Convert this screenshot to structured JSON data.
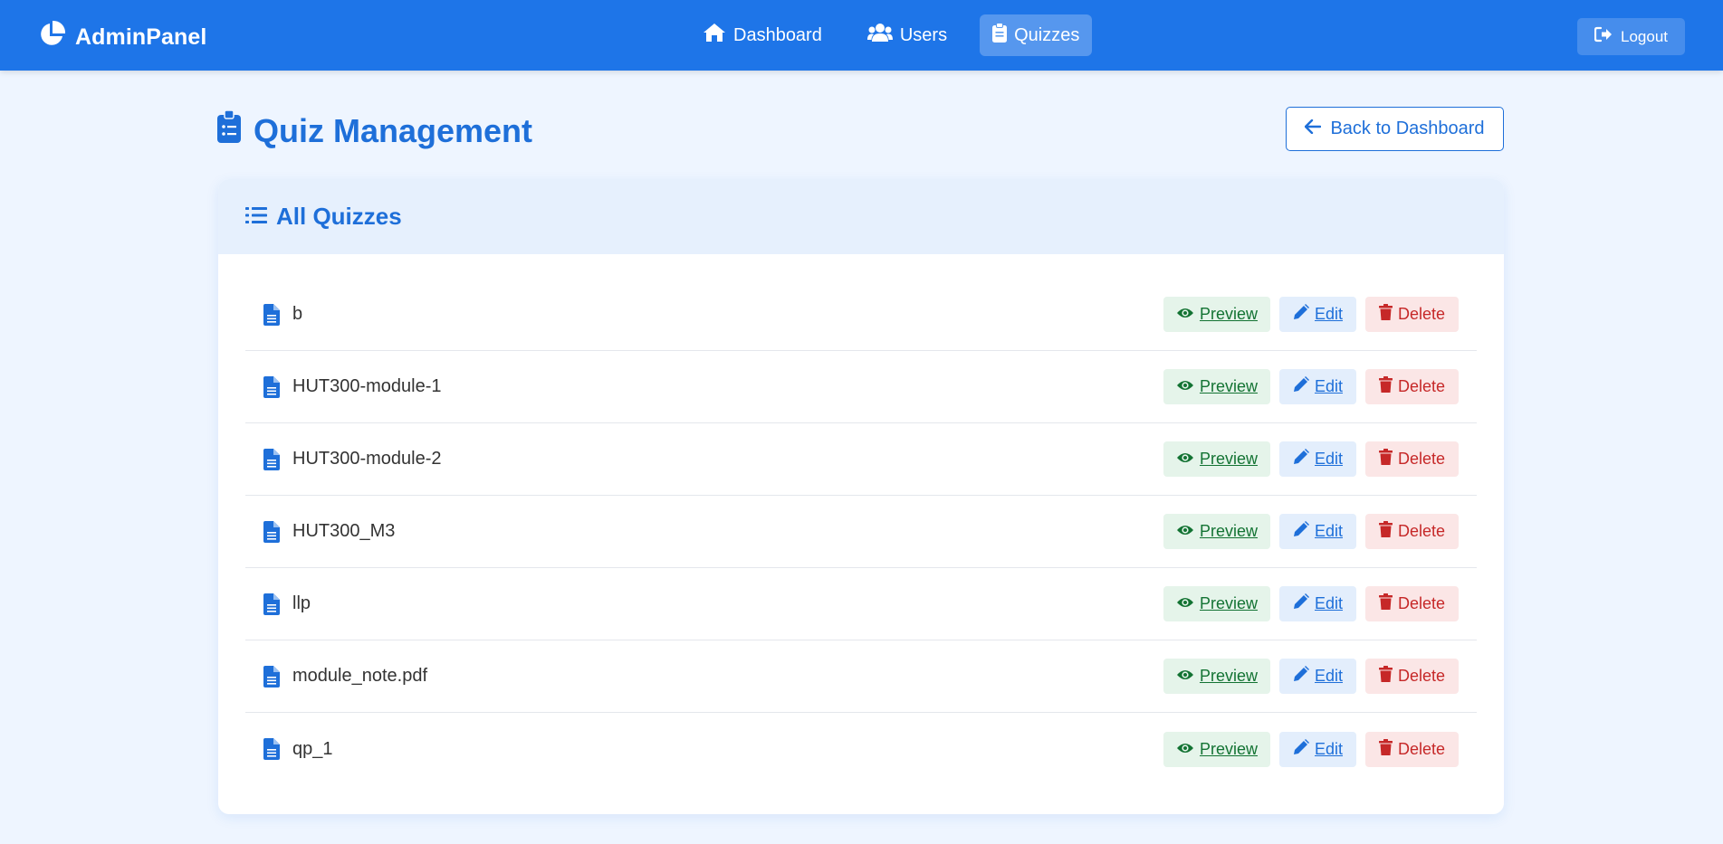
{
  "navbar": {
    "brand": "AdminPanel",
    "brand_icon": "chart-pie-icon",
    "links": [
      {
        "label": "Dashboard",
        "icon": "home-icon",
        "active": false
      },
      {
        "label": "Users",
        "icon": "users-icon",
        "active": false
      },
      {
        "label": "Quizzes",
        "icon": "clipboard-icon",
        "active": true
      }
    ],
    "logout_label": "Logout"
  },
  "page": {
    "title": "Quiz Management",
    "back_label": "Back to Dashboard"
  },
  "card": {
    "title": "All Quizzes",
    "actions": {
      "preview": "Preview",
      "edit": "Edit",
      "delete": "Delete"
    },
    "quizzes": [
      {
        "name": "b"
      },
      {
        "name": "HUT300-module-1"
      },
      {
        "name": "HUT300-module-2"
      },
      {
        "name": "HUT300_M3"
      },
      {
        "name": "llp"
      },
      {
        "name": "module_note.pdf"
      },
      {
        "name": "qp_1"
      }
    ]
  },
  "colors": {
    "primary": "#1e75e8",
    "background": "#eef5ff",
    "preview": "#137333",
    "edit": "#1e6fd9",
    "delete": "#c62828"
  }
}
